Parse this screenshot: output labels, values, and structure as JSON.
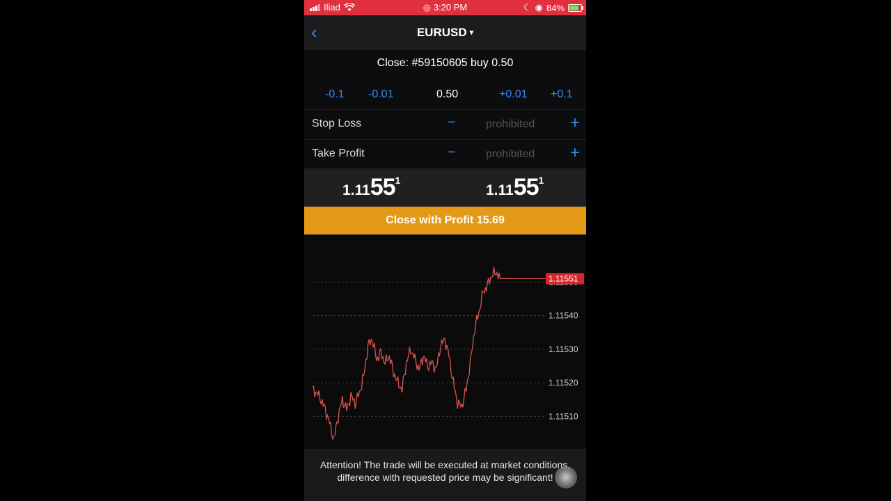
{
  "status_bar": {
    "carrier": "Iliad",
    "time": "3:20 PM",
    "battery": "84%"
  },
  "nav": {
    "title": "EURUSD",
    "dropdown_glyph": "▾",
    "back_glyph": "‹"
  },
  "order": {
    "title": "Close: #59150605 buy 0.50"
  },
  "volume": {
    "minus_big": "-0.1",
    "minus_small": "-0.01",
    "value": "0.50",
    "plus_small": "+0.01",
    "plus_big": "+0.1"
  },
  "stop_loss": {
    "label": "Stop Loss",
    "placeholder": "prohibited",
    "minus": "−",
    "plus": "+"
  },
  "take_profit": {
    "label": "Take Profit",
    "placeholder": "prohibited",
    "minus": "−",
    "plus": "+"
  },
  "quotes": {
    "bid": {
      "small": "1.11",
      "big": "55",
      "tiny": "1"
    },
    "ask": {
      "small": "1.11",
      "big": "55",
      "tiny": "1"
    }
  },
  "close_button": {
    "label": "Close with Profit 15.69",
    "color": "#e39a16"
  },
  "chart_data": {
    "type": "line",
    "symbol": "EURUSD",
    "current_price": "1.11551",
    "ylim": [
      1.11502,
      1.1156
    ],
    "y_ticks": [
      "1.11550",
      "1.11540",
      "1.11530",
      "1.11520",
      "1.11510"
    ],
    "line_color": "#d9534f",
    "grid": true,
    "series": [
      {
        "values": [
          1.11518,
          1.11517,
          1.11515,
          1.11512,
          1.11508,
          1.11503,
          1.1151,
          1.11515,
          1.11512,
          1.11516,
          1.11514,
          1.11517,
          1.11522,
          1.11531,
          1.11533,
          1.11527,
          1.11529,
          1.11526,
          1.11528,
          1.11523,
          1.1152,
          1.11518,
          1.11526,
          1.1153,
          1.11527,
          1.11524,
          1.11528,
          1.11525,
          1.11526,
          1.11524,
          1.11531,
          1.11533,
          1.11528,
          1.1152,
          1.11514,
          1.11513,
          1.11518,
          1.11526,
          1.11536,
          1.11541,
          1.11547,
          1.11549,
          1.11552,
          1.11553,
          1.11551,
          1.11551,
          1.11551,
          1.11551
        ]
      }
    ]
  },
  "attention": {
    "text": "Attention! The trade will be executed at market conditions, difference with requested price may be significant!"
  }
}
